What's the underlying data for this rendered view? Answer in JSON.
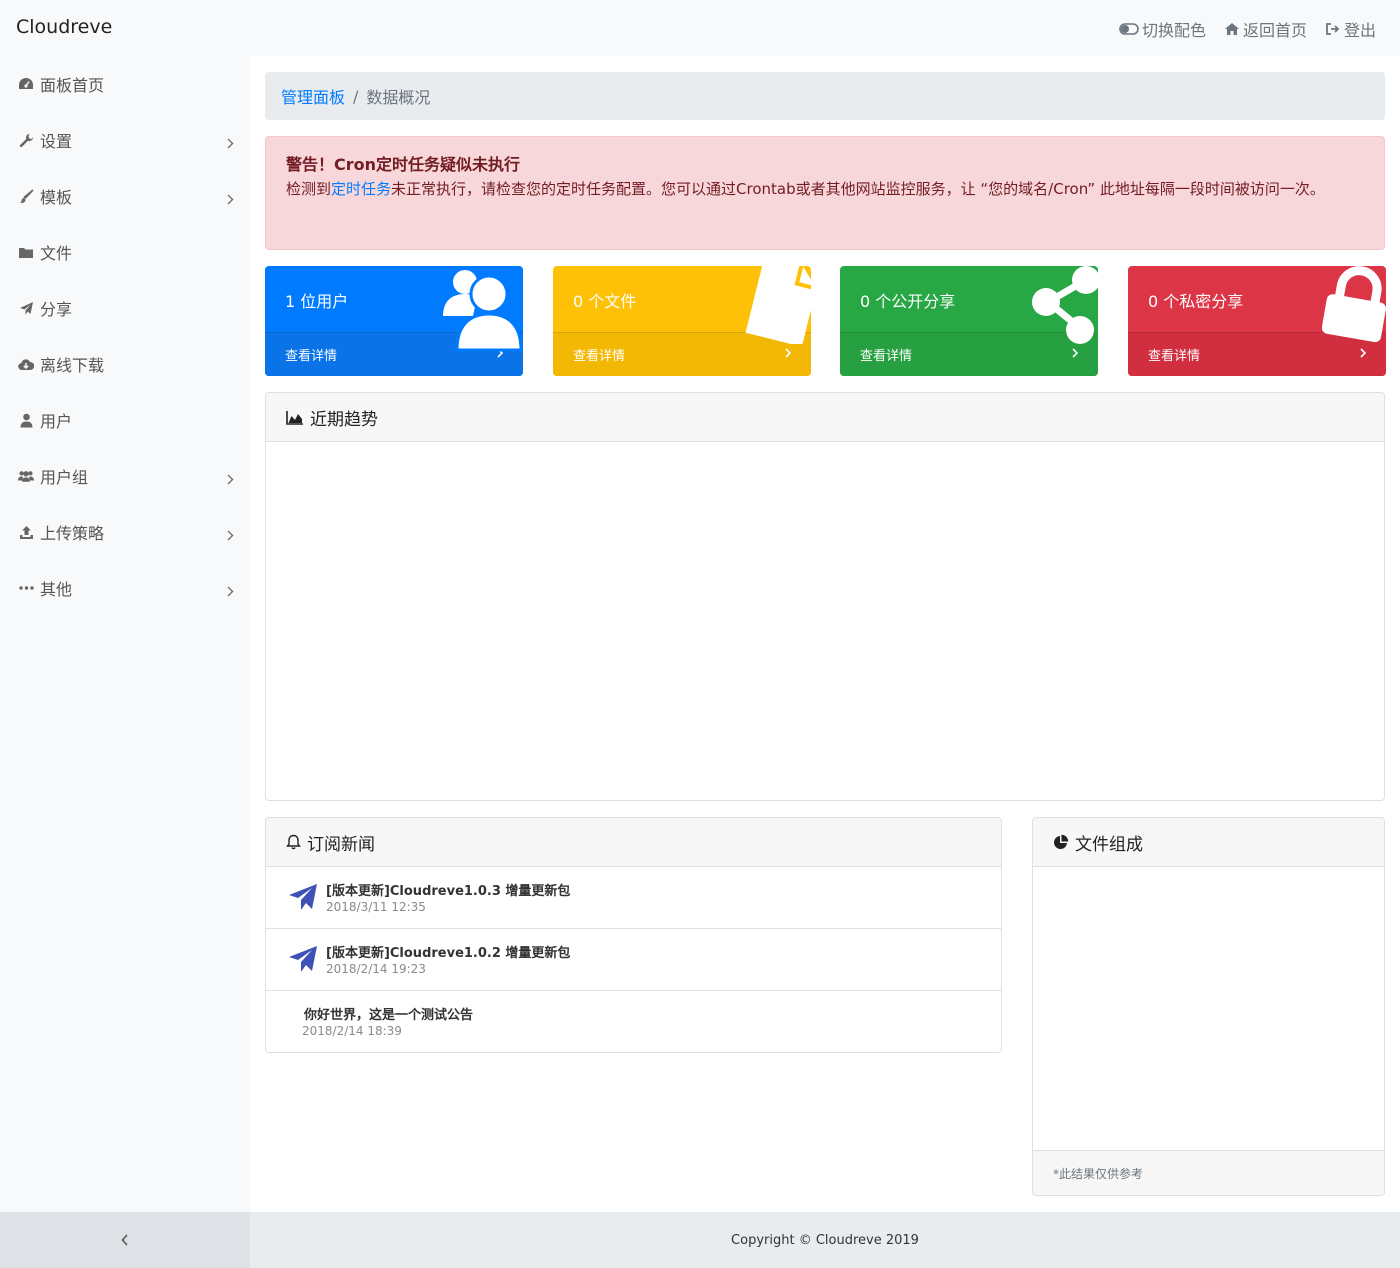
{
  "app": {
    "brand": "Cloudreve"
  },
  "topnav": [
    {
      "label": "切换配色",
      "icon": "toggle-icon"
    },
    {
      "label": "返回首页",
      "icon": "home-icon"
    },
    {
      "label": "登出",
      "icon": "logout-icon"
    }
  ],
  "sidebar": {
    "items": [
      {
        "label": "面板首页",
        "icon": "dashboard-icon",
        "has_children": false
      },
      {
        "label": "设置",
        "icon": "wrench-icon",
        "has_children": true
      },
      {
        "label": "模板",
        "icon": "brush-icon",
        "has_children": true
      },
      {
        "label": "文件",
        "icon": "folder-icon",
        "has_children": false
      },
      {
        "label": "分享",
        "icon": "paper-plane-icon",
        "has_children": false
      },
      {
        "label": "离线下载",
        "icon": "cloud-download-icon",
        "has_children": false
      },
      {
        "label": "用户",
        "icon": "user-icon",
        "has_children": false
      },
      {
        "label": "用户组",
        "icon": "users-icon",
        "has_children": true
      },
      {
        "label": "上传策略",
        "icon": "upload-icon",
        "has_children": true
      },
      {
        "label": "其他",
        "icon": "ellipsis-icon",
        "has_children": true
      }
    ],
    "collapse_icon": "chevron-left-icon"
  },
  "breadcrumb": {
    "root": "管理面板",
    "separator": "/",
    "current": "数据概况"
  },
  "alert": {
    "title": "警告！Cron定时任务疑似未执行",
    "body_prefix": "检测到",
    "body_link": "定时任务",
    "body_suffix": "未正常执行，请检查您的定时任务配置。您可以通过Crontab或者其他网站监控服务，让 “您的域名/Cron” 此地址每隔一段时间被访问一次。"
  },
  "stats": [
    {
      "label": "1 位用户",
      "link": "查看详情",
      "color": "#007bff",
      "icon": "users-icon"
    },
    {
      "label": "0 个文件",
      "link": "查看详情",
      "color": "#ffc107",
      "icon": "file-icon"
    },
    {
      "label": "0 个公开分享",
      "link": "查看详情",
      "color": "#28a745",
      "icon": "share-icon"
    },
    {
      "label": "0 个私密分享",
      "link": "查看详情",
      "color": "#dc3545",
      "icon": "lock-icon"
    }
  ],
  "trend": {
    "title": "近期趋势",
    "icon": "area-chart-icon"
  },
  "news": {
    "title": "订阅新闻",
    "icon": "bell-icon",
    "items": [
      {
        "title": "[版本更新]Cloudreve1.0.3 增量更新包",
        "date": "2018/3/11 12:35",
        "icon": "paper-plane-icon"
      },
      {
        "title": "[版本更新]Cloudreve1.0.2 增量更新包",
        "date": "2018/2/14 19:23",
        "icon": "paper-plane-icon"
      },
      {
        "title": "你好世界，这是一个测试公告",
        "date": "2018/2/14 18:39",
        "icon": ""
      }
    ]
  },
  "composition": {
    "title": "文件组成",
    "icon": "pie-chart-icon",
    "note": "*此结果仅供参考"
  },
  "footer": {
    "copyright": "Copyright © Cloudreve 2019"
  }
}
